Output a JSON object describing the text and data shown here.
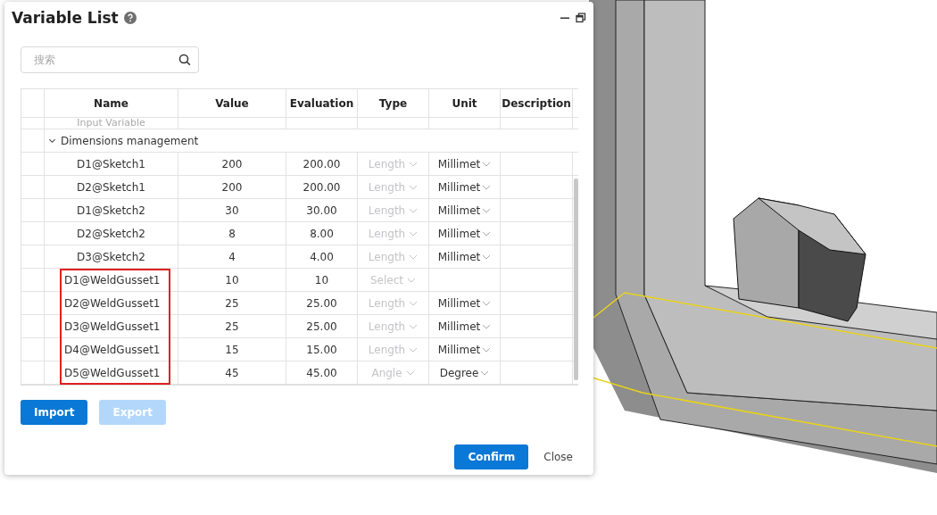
{
  "dialog": {
    "title": "Variable List",
    "search": {
      "placeholder": "搜索"
    },
    "table": {
      "columns": [
        "Name",
        "Value",
        "Evaluation",
        "Type",
        "Unit",
        "Description"
      ],
      "rows": [
        {
          "kind": "partial",
          "name": "Input Variable"
        },
        {
          "kind": "group",
          "name": "Dimensions management",
          "expanded": true
        },
        {
          "kind": "variable",
          "name": "D1@Sketch1",
          "value": "200",
          "evaluation": "200.00",
          "type": "Length",
          "type_disabled": true,
          "unit": "Millimet",
          "highlighted": false
        },
        {
          "kind": "variable",
          "name": "D2@Sketch1",
          "value": "200",
          "evaluation": "200.00",
          "type": "Length",
          "type_disabled": true,
          "unit": "Millimet",
          "highlighted": false
        },
        {
          "kind": "variable",
          "name": "D1@Sketch2",
          "value": "30",
          "evaluation": "30.00",
          "type": "Length",
          "type_disabled": true,
          "unit": "Millimet",
          "highlighted": false
        },
        {
          "kind": "variable",
          "name": "D2@Sketch2",
          "value": "8",
          "evaluation": "8.00",
          "type": "Length",
          "type_disabled": true,
          "unit": "Millimet",
          "highlighted": false
        },
        {
          "kind": "variable",
          "name": "D3@Sketch2",
          "value": "4",
          "evaluation": "4.00",
          "type": "Length",
          "type_disabled": true,
          "unit": "Millimet",
          "highlighted": false
        },
        {
          "kind": "variable",
          "name": "D1@WeldGusset1",
          "value": "10",
          "evaluation": "10",
          "type": "Select",
          "type_disabled": true,
          "highlighted": true
        },
        {
          "kind": "variable",
          "name": "D2@WeldGusset1",
          "value": "25",
          "evaluation": "25.00",
          "type": "Length",
          "type_disabled": true,
          "unit": "Millimet",
          "highlighted": true
        },
        {
          "kind": "variable",
          "name": "D3@WeldGusset1",
          "value": "25",
          "evaluation": "25.00",
          "type": "Length",
          "type_disabled": true,
          "unit": "Millimet",
          "highlighted": true
        },
        {
          "kind": "variable",
          "name": "D4@WeldGusset1",
          "value": "15",
          "evaluation": "15.00",
          "type": "Length",
          "type_disabled": true,
          "unit": "Millimet",
          "highlighted": true
        },
        {
          "kind": "variable",
          "name": "D5@WeldGusset1",
          "value": "45",
          "evaluation": "45.00",
          "type": "Angle",
          "type_disabled": true,
          "unit": "Degree",
          "highlighted": true
        }
      ]
    },
    "actions": [
      {
        "label": "Import",
        "disabled": false
      },
      {
        "label": "Export",
        "disabled": true
      }
    ],
    "footer": [
      {
        "label": "Confirm",
        "kind": "primary"
      },
      {
        "label": "Close",
        "kind": "text"
      }
    ]
  }
}
